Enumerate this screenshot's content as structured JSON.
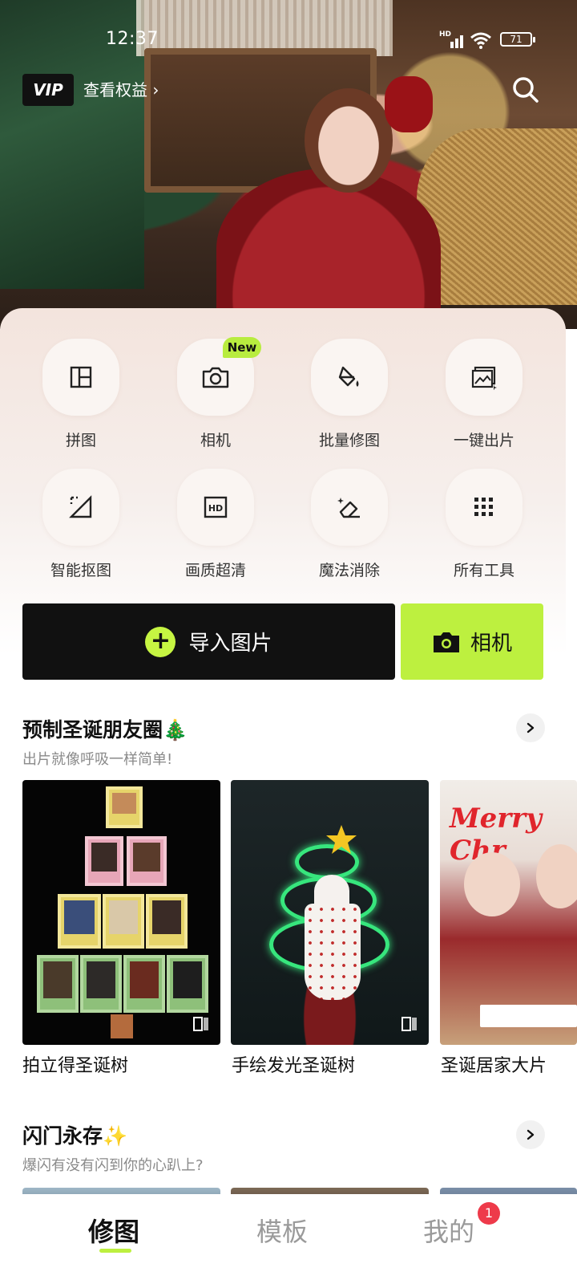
{
  "status_bar": {
    "time": "12:37",
    "network": "HD",
    "battery": "71"
  },
  "header": {
    "vip_label": "VIP",
    "benefits_link": "查看权益 ›"
  },
  "hero": {
    "image": "christmas-portrait-banner"
  },
  "tools": [
    {
      "label": "拼图",
      "icon": "collage-icon"
    },
    {
      "label": "相机",
      "icon": "camera-icon",
      "badge": "New"
    },
    {
      "label": "批量修图",
      "icon": "batch-edit-icon"
    },
    {
      "label": "一键出片",
      "icon": "one-click-icon"
    },
    {
      "label": "智能抠图",
      "icon": "cutout-icon"
    },
    {
      "label": "画质超清",
      "icon": "hd-icon"
    },
    {
      "label": "魔法消除",
      "icon": "eraser-icon"
    },
    {
      "label": "所有工具",
      "icon": "grid-icon"
    }
  ],
  "actions": {
    "import_label": "导入图片",
    "camera_label": "相机"
  },
  "sections": [
    {
      "title": "预制圣诞朋友圈🎄",
      "subtitle": "出片就像呼吸一样简单!",
      "cards": [
        {
          "title": "拍立得圣诞树"
        },
        {
          "title": "手绘发光圣诞树"
        },
        {
          "title": "圣诞居家大片"
        }
      ]
    },
    {
      "title": "闪门永存✨",
      "subtitle": "爆闪有没有闪到你的心趴上?"
    }
  ],
  "bottom_nav": {
    "items": [
      {
        "label": "修图",
        "active": true
      },
      {
        "label": "模板",
        "active": false
      },
      {
        "label": "我的",
        "active": false,
        "badge": "1"
      }
    ]
  },
  "colors": {
    "accent": "#bdf03f",
    "badge_red": "#ee3a4a",
    "dark": "#111111"
  }
}
